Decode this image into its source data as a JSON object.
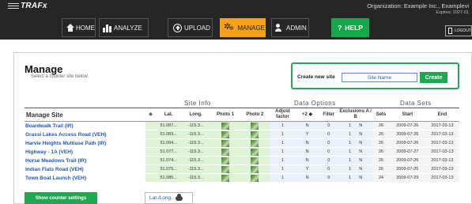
{
  "header": {
    "logo": "TRAFx",
    "org": "Organization: Example Inc., Examplevi",
    "expires": "Expires: 2027-01",
    "nav": [
      {
        "label": "HOME",
        "icon": "home-icon"
      },
      {
        "label": "ANALYZE",
        "icon": "bar-chart-icon"
      },
      {
        "label": "UPLOAD",
        "icon": "upload-icon"
      },
      {
        "label": "MANAGE",
        "icon": "gears-icon",
        "active": true
      },
      {
        "label": "ADMIN",
        "icon": "users-icon"
      },
      {
        "label": "HELP",
        "icon": "question-icon",
        "prefix": "?"
      },
      {
        "label": "LOGOUT",
        "icon": "logout-icon"
      }
    ],
    "colors": {
      "bar": "#262626",
      "active": "#f6a11a",
      "help": "#15a84a"
    }
  },
  "page": {
    "title": "Manage",
    "subtitle": "Select a counter site below.",
    "new_site": {
      "label": "Create new site",
      "placeholder": "Site Name",
      "button": "Create"
    }
  },
  "table": {
    "groups": {
      "site_info": "Site Info",
      "data_options": "Data Options",
      "data_sets": "Data Sets"
    },
    "columns": {
      "site": "Manage Site",
      "sort": "◆",
      "lat": "Lat.",
      "long": "Long.",
      "photo1": "Photo 1",
      "photo2": "Photo 2",
      "adjust": "Adjust factor",
      "plus2": "+2 ◆",
      "filter": "Filter",
      "exclusions": "Exclusions A / B",
      "sets": "Sets",
      "start": "Start",
      "end": "End"
    },
    "rows": [
      {
        "site": "Boardwalk Trail (IR)",
        "lat": "51.087...",
        "long": "-115.3...",
        "adjust": "1",
        "plus2": "N",
        "filter": "0",
        "exA": "1",
        "exB": "N",
        "sets": "26",
        "start": "2009-07-26",
        "end": "2017-03-13"
      },
      {
        "site": "Grassi Lakes Access Road (VEH)",
        "lat": "51.083...",
        "long": "-115.3...",
        "adjust": "1",
        "plus2": "Y",
        "filter": "0",
        "exA": "1",
        "exB": "N",
        "sets": "26",
        "start": "2009-07-26",
        "end": "2017-03-13"
      },
      {
        "site": "Harvie Heights Multiuse Path (IR)",
        "lat": "51.094...",
        "long": "-115.3...",
        "adjust": "1",
        "plus2": "N",
        "filter": "0",
        "exA": "1",
        "exB": "N",
        "sets": "26",
        "start": "2009-07-26",
        "end": "2017-03-13"
      },
      {
        "site": "Highway - 1A (VEH)",
        "lat": "51.077...",
        "long": "-115.3...",
        "adjust": "1",
        "plus2": "N",
        "filter": "0",
        "exA": "1",
        "exB": "N",
        "sets": "26",
        "start": "2009-07-27",
        "end": "2017-03-13"
      },
      {
        "site": "Horse Meadows Trail (IR)",
        "lat": "51.074...",
        "long": "-115.3...",
        "adjust": "1",
        "plus2": "N",
        "filter": "0",
        "exA": "1",
        "exB": "N",
        "sets": "26",
        "start": "2009-07-26",
        "end": "2017-03-13"
      },
      {
        "site": "Indian Flats Road (VEH)",
        "lat": "51.075...",
        "long": "-115.3...",
        "adjust": "1",
        "plus2": "Y",
        "filter": "0",
        "exA": "1",
        "exB": "N",
        "sets": "26",
        "start": "2009-07-26",
        "end": "2017-03-13"
      },
      {
        "site": "Town Boat Launch (VEH)",
        "lat": "51.085...",
        "long": "-115.3...",
        "adjust": "1",
        "plus2": "N",
        "filter": "0",
        "exA": "1",
        "exB": "N",
        "sets": "24",
        "start": "2009-07-29",
        "end": "2017-03-13"
      }
    ]
  },
  "footer": {
    "show_settings": "Show counter settings",
    "latlong": "Lat./Long."
  }
}
